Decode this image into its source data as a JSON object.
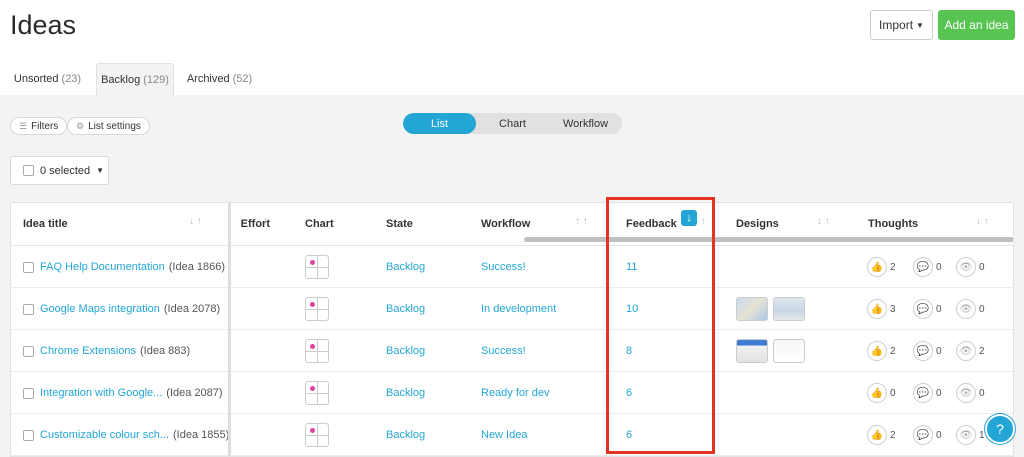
{
  "page": {
    "title": "Ideas"
  },
  "header": {
    "import_label": "Import",
    "add_label": "Add an idea"
  },
  "tabs": [
    {
      "label": "Unsorted",
      "count": "(23)"
    },
    {
      "label": "Backlog",
      "count": "(129)"
    },
    {
      "label": "Archived",
      "count": "(52)"
    }
  ],
  "toolbar": {
    "filters_label": "Filters",
    "list_settings_label": "List settings"
  },
  "views": [
    "List",
    "Chart",
    "Workflow"
  ],
  "selection": {
    "label": "0 selected"
  },
  "table": {
    "columns": {
      "title": "Idea title",
      "effort": "Effort",
      "chart": "Chart",
      "state": "State",
      "workflow": "Workflow",
      "feedback": "Feedback",
      "designs": "Designs",
      "thoughts": "Thoughts"
    },
    "rows": [
      {
        "title": "FAQ Help Documentation",
        "ref": "(Idea 1866)",
        "state": "Backlog",
        "workflow": "Success!",
        "feedback": "11",
        "likes": "2",
        "comments": "0",
        "views": "0"
      },
      {
        "title": "Google Maps integration",
        "ref": "(Idea 2078)",
        "state": "Backlog",
        "workflow": "In development",
        "feedback": "10",
        "likes": "3",
        "comments": "0",
        "views": "0"
      },
      {
        "title": "Chrome Extensions",
        "ref": "(Idea 883)",
        "state": "Backlog",
        "workflow": "Success!",
        "feedback": "8",
        "likes": "2",
        "comments": "0",
        "views": "2"
      },
      {
        "title": "Integration with Google...",
        "ref": "(Idea 2087)",
        "state": "Backlog",
        "workflow": "Ready for dev",
        "feedback": "6",
        "likes": "0",
        "comments": "0",
        "views": "0"
      },
      {
        "title": "Customizable colour sch...",
        "ref": "(Idea 1855)",
        "state": "Backlog",
        "workflow": "New Idea",
        "feedback": "6",
        "likes": "2",
        "comments": "0",
        "views": "1"
      }
    ]
  },
  "help": {
    "label": "?"
  },
  "colors": {
    "accent": "#23a6d5",
    "primary_button": "#58c552",
    "highlight": "#e53222"
  }
}
